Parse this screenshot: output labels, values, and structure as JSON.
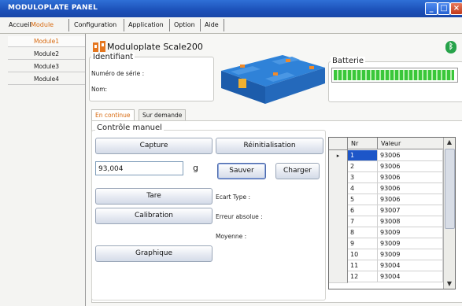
{
  "window": {
    "title": "MODULOPLATE PANEL"
  },
  "menu": [
    {
      "label": "Accueil",
      "active": false
    },
    {
      "label": "Module",
      "active": true
    },
    {
      "label": "Configuration",
      "active": false
    },
    {
      "label": "Application",
      "active": false
    },
    {
      "label": "Option",
      "active": false
    },
    {
      "label": "Aide",
      "active": false
    }
  ],
  "nav": [
    {
      "label": "Module1",
      "active": true
    },
    {
      "label": "Module2",
      "active": false
    },
    {
      "label": "Module3",
      "active": false
    },
    {
      "label": "Module4",
      "active": false
    }
  ],
  "device": {
    "title": "Moduloplate Scale200"
  },
  "identifiant": {
    "title": "Identifiant",
    "serial_label": "Numéro de série :",
    "name_label": "Nom:"
  },
  "battery": {
    "title": "Batterie",
    "level_percent": 100,
    "color": "#3ac73a"
  },
  "tabs": [
    {
      "label": "En continue",
      "active": true
    },
    {
      "label": "Sur demande",
      "active": false
    }
  ],
  "manual": {
    "title": "Contrôle manuel",
    "capture": "Capture",
    "reset": "Réinitialisation",
    "weight_value": "93,004",
    "unit": "g",
    "save": "Sauver",
    "load": "Charger",
    "tare": "Tare",
    "calibration": "Calibration",
    "graph": "Graphique",
    "std_label": "Ecart Type :",
    "abs_err_label": "Erreur absolue :",
    "mean_label": "Moyenne :"
  },
  "table": {
    "columns": [
      "Nr",
      "Valeur"
    ],
    "rows": [
      {
        "nr": "1",
        "value": "93006"
      },
      {
        "nr": "2",
        "value": "93006"
      },
      {
        "nr": "3",
        "value": "93006"
      },
      {
        "nr": "4",
        "value": "93006"
      },
      {
        "nr": "5",
        "value": "93006"
      },
      {
        "nr": "6",
        "value": "93007"
      },
      {
        "nr": "7",
        "value": "93008"
      },
      {
        "nr": "8",
        "value": "93009"
      },
      {
        "nr": "9",
        "value": "93009"
      },
      {
        "nr": "10",
        "value": "93009"
      },
      {
        "nr": "11",
        "value": "93004"
      },
      {
        "nr": "12",
        "value": "93004"
      }
    ],
    "selected_row": 0
  },
  "colors": {
    "titlebar": "#1c50b8",
    "active": "#d86a10",
    "selection": "#1d56c8"
  }
}
